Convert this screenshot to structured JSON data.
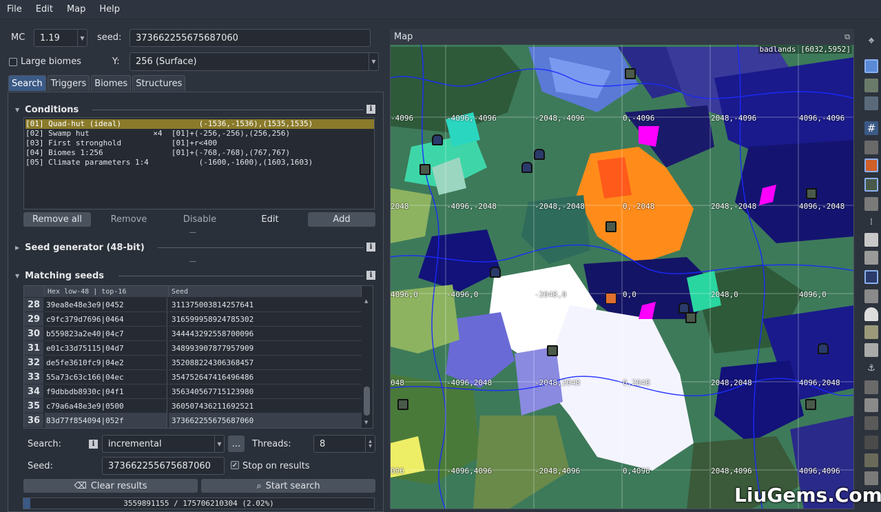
{
  "menu": [
    "File",
    "Edit",
    "Map",
    "Help"
  ],
  "top": {
    "mc_label": "MC",
    "mc_version": "1.19",
    "seed_label": "seed:",
    "seed_value": "373662255675687060",
    "large_biomes": "Large biomes",
    "y_label": "Y:",
    "y_value": "256 (Surface)"
  },
  "tabs": [
    "Search",
    "Triggers",
    "Biomes",
    "Structures"
  ],
  "conditions": {
    "title": "Conditions",
    "items": [
      "[01] Quad-hut (ideal)                 (-1536,-1536),(1535,1535)",
      "[02] Swamp hut              ×4  [01]+(-256,-256),(256,256)",
      "[03] First stronghold           [01]+r<400",
      "[04] Biomes 1:256               [01]+(-768,-768),(767,767)",
      "[05] Climate parameters 1:4           (-1600,-1600),(1603,1603)"
    ],
    "buttons": {
      "remove_all": "Remove all",
      "remove": "Remove",
      "disable": "Disable",
      "edit": "Edit",
      "add": "Add"
    }
  },
  "seed_generator": {
    "title": "Seed generator (48-bit)"
  },
  "matching": {
    "title": "Matching seeds",
    "col_hex": "Hex  low-48 | top-16",
    "col_seed": "Seed",
    "rows": [
      {
        "n": "28",
        "hex": "39ea8e48e3e9|0452",
        "seed": "311375003814257641"
      },
      {
        "n": "29",
        "hex": "c9fc379d7696|0464",
        "seed": "316599958924785302"
      },
      {
        "n": "30",
        "hex": "b559823a2e40|04c7",
        "seed": "344443292558700096"
      },
      {
        "n": "31",
        "hex": "e01c33d75115|04d7",
        "seed": "348993907877957909"
      },
      {
        "n": "32",
        "hex": "de5fe3610fc9|04e2",
        "seed": "352088224306368457"
      },
      {
        "n": "33",
        "hex": "55a73c63c166|04ec",
        "seed": "354752647416496486"
      },
      {
        "n": "34",
        "hex": "f9dbbdb8930c|04f1",
        "seed": "356340567715123980"
      },
      {
        "n": "35",
        "hex": "c79a6a48e3e9|0500",
        "seed": "360507436211692521"
      },
      {
        "n": "36",
        "hex": "83d77f854094|052f",
        "seed": "373662255675687060"
      }
    ]
  },
  "search": {
    "search_label": "Search:",
    "mode": "incremental",
    "ellipsis": "...",
    "threads_label": "Threads:",
    "threads": "8",
    "seed_label": "Seed:",
    "seed": "373662255675687060",
    "stop_on_results": "Stop on results",
    "clear": "Clear results",
    "start": "Start search",
    "progress": "3559891155 / 175706210304 (2.02%)",
    "progress_fraction": 0.0202
  },
  "map": {
    "title": "Map",
    "status": "badlands [6032,5952]",
    "grid_labels": [
      [
        "-4096",
        "-4096,-4096",
        "-2048,-4096",
        "0,-4096",
        "2048,-4096",
        "4096,-4096"
      ],
      [
        "2048",
        "-4096,-2048",
        "-2048,-2048",
        "0,-2048",
        "2048,-2048",
        "4096,-2048"
      ],
      [
        "4096,0",
        "-4096,0",
        "-2048,0",
        "0,0",
        "2048,0",
        "4096,0"
      ],
      [
        "048",
        "-4096,2048",
        "-2048,2048",
        "0,2048",
        "2048,2048",
        "4096,2048"
      ],
      [
        "096",
        "-4096,4096",
        "-2048,4096",
        "0,4096",
        "2048,4096",
        "4096,4096"
      ]
    ]
  },
  "watermark": "LiuGems.Com",
  "colors": {
    "accent": "#3b5a86",
    "selected": "#8a7a2a",
    "ocean": "#1a1a8c",
    "swamp": "#2e6b5a",
    "plains": "#8db360",
    "snow": "#ffffff",
    "badlands": "#ff8c1a"
  }
}
